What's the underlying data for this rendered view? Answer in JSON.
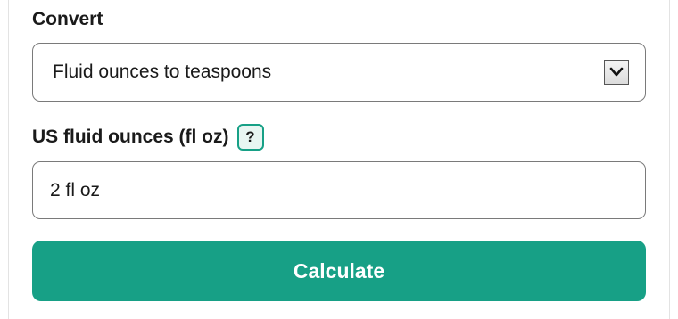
{
  "form": {
    "convert_label": "Convert",
    "convert_selected": "Fluid ounces to teaspoons",
    "amount_label": "US fluid ounces (fl oz)",
    "help_label": "?",
    "amount_value": "2 fl oz",
    "calculate_label": "Calculate"
  },
  "colors": {
    "accent": "#17a086",
    "help_bg": "#e8f6f2",
    "border": "#7a7a7a"
  },
  "icons": {
    "select_arrow": "chevron-down-icon"
  }
}
